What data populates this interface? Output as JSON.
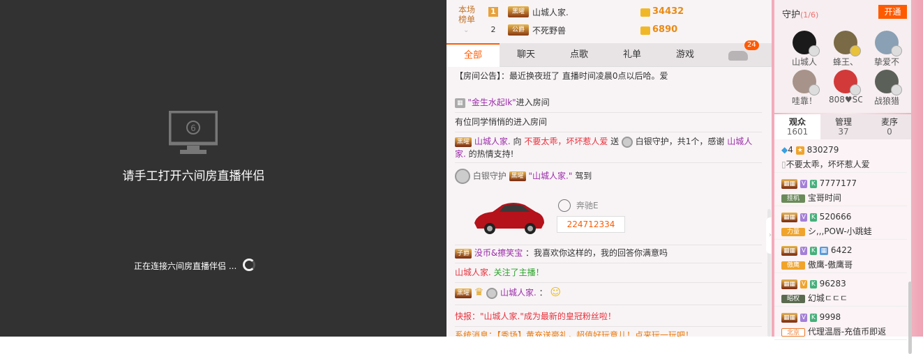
{
  "stage": {
    "title": "请手工打开六间房直播伴侣",
    "status": "正在连接六间房直播伴侣 ..."
  },
  "ranking": {
    "label_line1": "本场",
    "label_line2": "榜单",
    "rows": [
      {
        "rank": "1",
        "badge": "黑曜",
        "name": "山城人家.",
        "score": "34432"
      },
      {
        "rank": "2",
        "badge": "公爵",
        "name": "不死野兽",
        "score": "6890"
      }
    ]
  },
  "tabs": {
    "all": "全部",
    "chat": "聊天",
    "song": "点歌",
    "gift": "礼单",
    "game": "游戏",
    "count": "24"
  },
  "feed": {
    "announcement": "【房间公告】：最近换夜班了 直播时间凌晨0点以后哈。爱",
    "enter1_name": "\"金生水起lk\"",
    "enter1_suffix": "进入房间",
    "enter2": "有位同学悄悄的进入房间",
    "thanks_badge": "黑曜",
    "thanks_user": "山城人家.",
    "thanks_to": " 向 ",
    "thanks_target": "不要太乖，坏坏惹人爱",
    "thanks_send": " 送 ",
    "thanks_rest": "白银守护，共1个，感谢",
    "thanks_user2": "山城人家.",
    "thanks_end": "的热情支持!",
    "guard_label": "白银守护",
    "guard_badge": "黑曜",
    "guard_user": "\"山城人家.\"",
    "guard_arrive": "驾到",
    "car_name": "奔驰E",
    "car_code": "224712334",
    "reply_badge": "子爵",
    "reply_user": "没币&擦笑宝",
    "reply_text": "：我喜欢你这样的，我的回答你满意吗",
    "follow_user": "山城人家.",
    "follow_text": "关注了主播！",
    "crown_badge": "黑曜",
    "crown_user": "山城人家.",
    "crown_colon": "：",
    "flash": "快报：\"山城人家.\"成为最新的皇冠粉丝啦！",
    "system": "系统消息：【秀场】黄充送豪礼，超值好玩意儿！点来玩一玩吧！"
  },
  "guards": {
    "title": "守护",
    "count": "(1/6)",
    "open_label": "开通",
    "list": [
      {
        "name": "山城人",
        "color": "#1a1a1a"
      },
      {
        "name": "蜂王、",
        "color": "#7a6a45"
      },
      {
        "name": "挚爱不",
        "color": "#8aa0b4"
      },
      {
        "name": "哇靠！",
        "color": "#a7938a"
      },
      {
        "name": "808♥SC",
        "color": "#d23a3a"
      },
      {
        "name": "战狼猎",
        "color": "#5b6058"
      }
    ]
  },
  "audience_tabs": [
    {
      "label": "观众",
      "count": "1601"
    },
    {
      "label": "管理",
      "count": "37"
    },
    {
      "label": "麦序",
      "count": "0"
    }
  ],
  "audience": [
    {
      "id": "830279",
      "name": "不要太乖，坏坏惹人爱",
      "level": "4",
      "tags": ""
    },
    {
      "id": "7777177",
      "name": "宝哥时间",
      "level": "挂机",
      "tags": "V K"
    },
    {
      "id": "520666",
      "name": "シ,,,POW-小跳蛙",
      "level": "力量",
      "tags": "V K"
    },
    {
      "id": "6422",
      "name": "傲鹰-傲鹰哥",
      "level": "傲鹰",
      "tags": "V K"
    },
    {
      "id": "96283",
      "name": "幻城ㄷㄷㄷ",
      "level": "昭权",
      "tags": "V K"
    },
    {
      "id": "9998",
      "name": "代理温唇-充值币即返",
      "level": "北京",
      "tags": "V K"
    }
  ],
  "colors": {
    "accent": "#ff5a00",
    "stage_bg": "#323232",
    "purple": "#9b2ba8",
    "red": "#e6313b"
  }
}
